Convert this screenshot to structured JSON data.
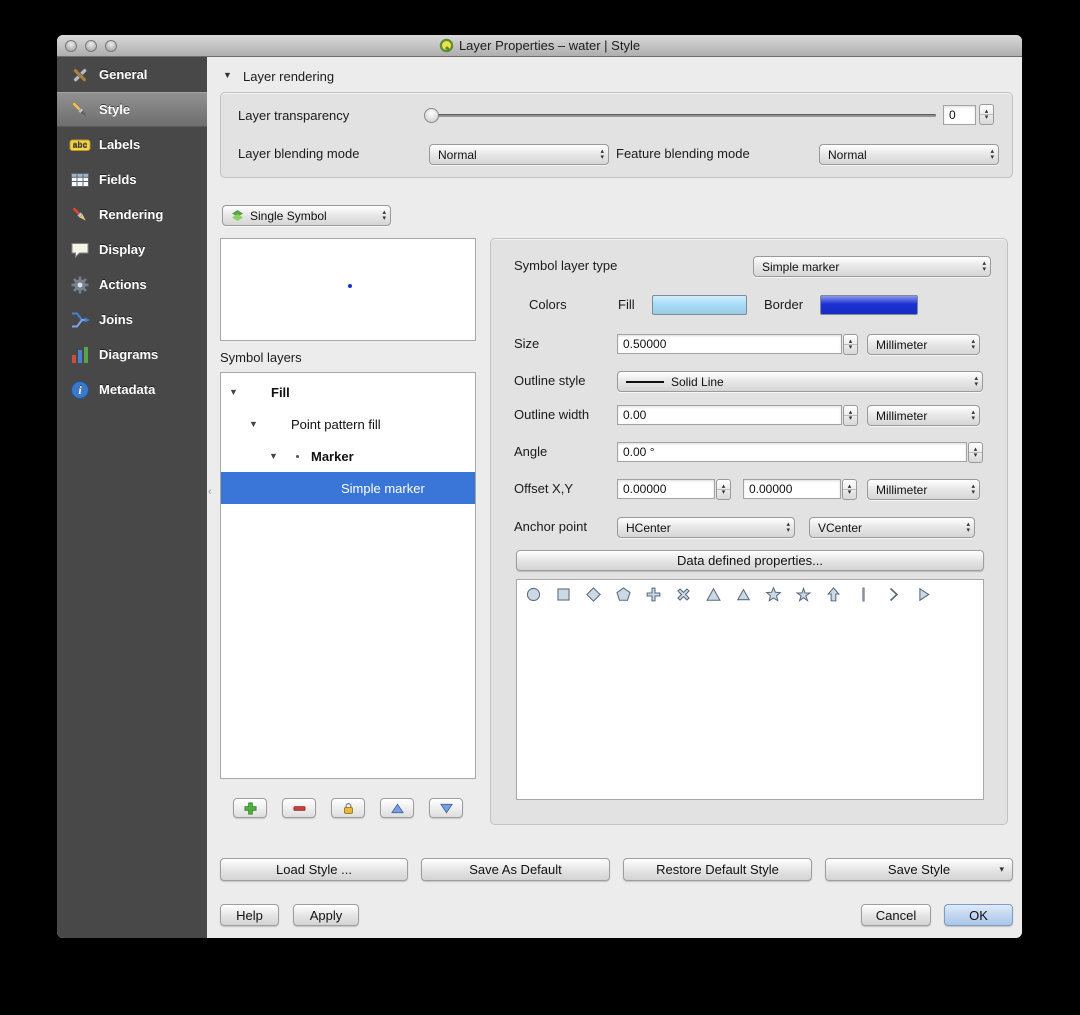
{
  "window": {
    "title": "Layer Properties – water | Style"
  },
  "sidebar": {
    "selected": "Style",
    "items": [
      {
        "label": "General"
      },
      {
        "label": "Style"
      },
      {
        "label": "Labels"
      },
      {
        "label": "Fields"
      },
      {
        "label": "Rendering"
      },
      {
        "label": "Display"
      },
      {
        "label": "Actions"
      },
      {
        "label": "Joins"
      },
      {
        "label": "Diagrams"
      },
      {
        "label": "Metadata"
      }
    ]
  },
  "rendering_section": {
    "title": "Layer rendering",
    "transparency": {
      "label": "Layer transparency",
      "value": "0"
    },
    "layer_blending": {
      "label": "Layer blending mode",
      "value": "Normal"
    },
    "feature_blending": {
      "label": "Feature blending mode",
      "value": "Normal"
    }
  },
  "renderer": {
    "value": "Single Symbol"
  },
  "symbol_layers": {
    "label": "Symbol layers",
    "selected": "Simple marker",
    "tree": [
      {
        "label": "Fill"
      },
      {
        "label": "Point pattern fill"
      },
      {
        "label": "Marker"
      },
      {
        "label": "Simple marker"
      }
    ]
  },
  "properties": {
    "symbol_layer_type": {
      "label": "Symbol layer type",
      "value": "Simple marker"
    },
    "colors": {
      "label": "Colors",
      "fill_label": "Fill",
      "fill_color": "#a6dcf8",
      "border_label": "Border",
      "border_color": "#1c31d4"
    },
    "size": {
      "label": "Size",
      "value": "0.50000",
      "unit": "Millimeter"
    },
    "outline_style": {
      "label": "Outline style",
      "value": "Solid Line"
    },
    "outline_width": {
      "label": "Outline width",
      "value": "0.00",
      "unit": "Millimeter"
    },
    "angle": {
      "label": "Angle",
      "value": "0.00 °"
    },
    "offset": {
      "label": "Offset X,Y",
      "x": "0.00000",
      "y": "0.00000",
      "unit": "Millimeter"
    },
    "anchor": {
      "label": "Anchor point",
      "h": "HCenter",
      "v": "VCenter"
    },
    "data_defined_button": "Data defined properties...",
    "marker_shapes": [
      "circle",
      "square",
      "diamond",
      "pentagon",
      "cross",
      "cross2",
      "triangle",
      "equilateral-triangle",
      "star",
      "regular-star",
      "arrow",
      "line",
      "chevron",
      "arrowhead"
    ]
  },
  "footer": {
    "load_style": "Load Style ...",
    "save_as_default": "Save As Default",
    "restore_default_style": "Restore Default Style",
    "save_style": "Save Style",
    "help": "Help",
    "apply": "Apply",
    "cancel": "Cancel",
    "ok": "OK"
  },
  "icons": {
    "spinner_up": "▴",
    "spinner_down": "▾",
    "disclosure_expanded": "▼",
    "save_style_arrow": "▾",
    "splitter": "‹"
  },
  "ui_colors": {
    "selection_blue": "#3a76d8",
    "sidebar_bg": "#484848"
  }
}
